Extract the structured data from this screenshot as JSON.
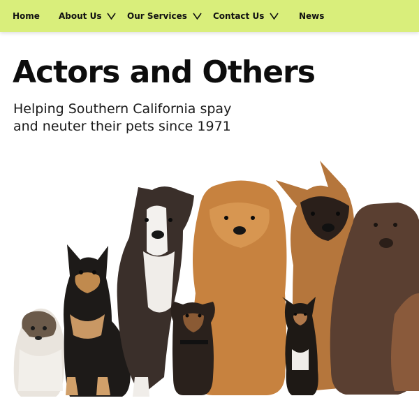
{
  "nav": {
    "home": "Home",
    "about": "About Us",
    "services": "Our Services",
    "contact": "Contact Us",
    "news": "News"
  },
  "hero": {
    "title": "Actors and Others",
    "subtitle_line1": "Helping Southern California spay",
    "subtitle_line2": "and neuter their pets since 1971"
  },
  "colors": {
    "nav_background": "#d9ee7b",
    "title_text": "#0d0d0d"
  },
  "icons": {
    "nav_dropdown": "chevron-down-icon"
  }
}
